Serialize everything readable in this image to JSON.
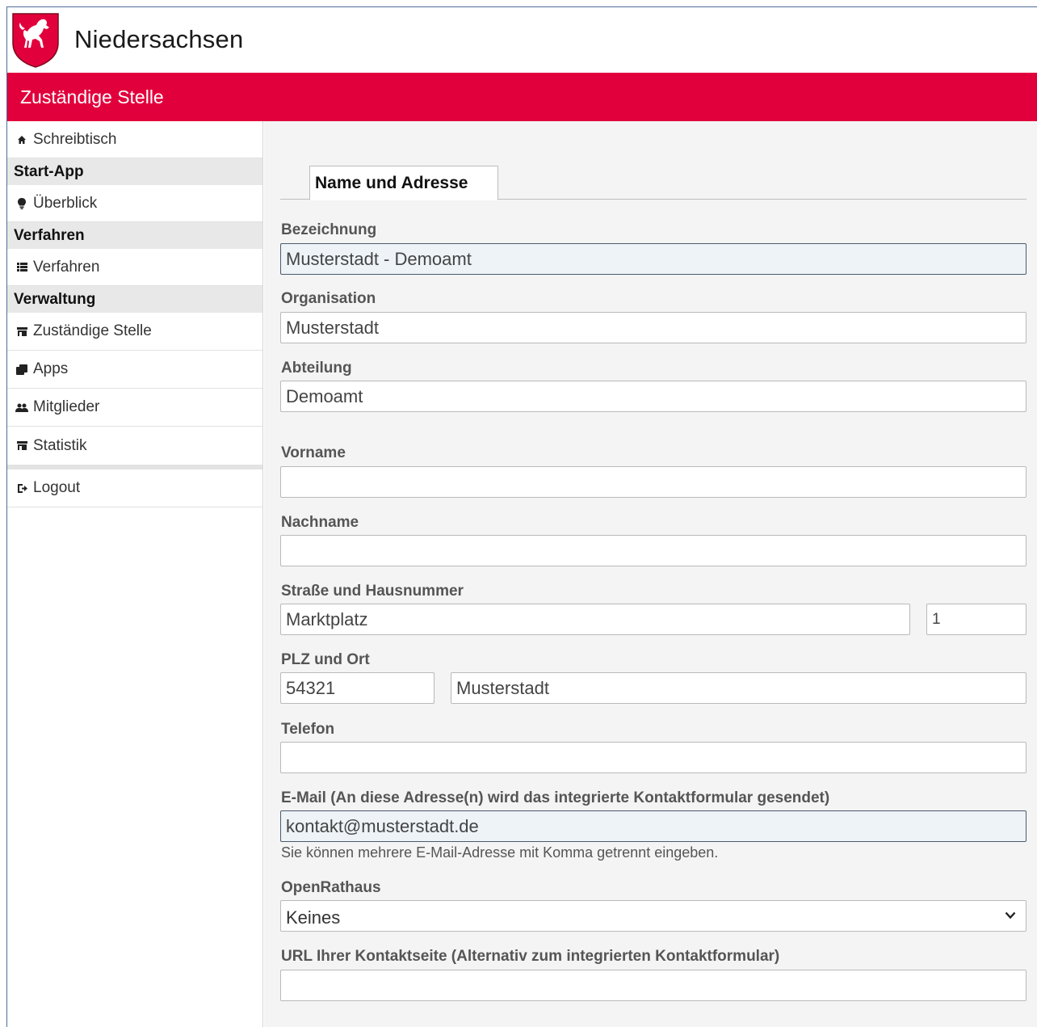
{
  "brand": {
    "name": "Niedersachsen",
    "crest": "lower-saxony-horse-crest"
  },
  "header": {
    "title": "Zuständige Stelle",
    "accent_color": "#e2003c"
  },
  "sidebar": {
    "home": {
      "label": "Schreibtisch",
      "icon": "home-icon"
    },
    "groups": [
      {
        "title": "Start-App",
        "items": [
          {
            "label": "Überblick",
            "icon": "lightbulb-icon"
          }
        ]
      },
      {
        "title": "Verfahren",
        "items": [
          {
            "label": "Verfahren",
            "icon": "list-icon"
          }
        ]
      },
      {
        "title": "Verwaltung",
        "items": [
          {
            "label": "Zuständige Stelle",
            "icon": "building-icon"
          },
          {
            "label": "Apps",
            "icon": "clone-icon"
          },
          {
            "label": "Mitglieder",
            "icon": "users-icon"
          },
          {
            "label": "Statistik",
            "icon": "building-icon"
          }
        ]
      }
    ],
    "logout": {
      "label": "Logout",
      "icon": "logout-icon"
    }
  },
  "tabs": [
    {
      "label": "Name und Adresse",
      "active": true
    }
  ],
  "form": {
    "bezeichnung": {
      "label": "Bezeichnung",
      "value": "Musterstadt - Demoamt"
    },
    "organisation": {
      "label": "Organisation",
      "value": "Musterstadt"
    },
    "abteilung": {
      "label": "Abteilung",
      "value": "Demoamt"
    },
    "vorname": {
      "label": "Vorname",
      "value": ""
    },
    "nachname": {
      "label": "Nachname",
      "value": ""
    },
    "strasse": {
      "label": "Straße und Hausnummer",
      "street_value": "Marktplatz",
      "number_value": "1"
    },
    "plz_ort": {
      "label": "PLZ und Ort",
      "plz_value": "54321",
      "ort_value": "Musterstadt"
    },
    "telefon": {
      "label": "Telefon",
      "value": ""
    },
    "email": {
      "label": "E-Mail (An diese Adresse(n) wird das integrierte Kontaktformular gesendet)",
      "value": "kontakt@musterstadt.de",
      "hint": "Sie können mehrere E-Mail-Adresse mit Komma getrennt eingeben."
    },
    "openrathaus": {
      "label": "OpenRathaus",
      "selected": "Keines"
    },
    "kontaktseite": {
      "label": "URL Ihrer Kontaktseite (Alternativ zum integrierten Kontaktformular)",
      "value": ""
    }
  }
}
